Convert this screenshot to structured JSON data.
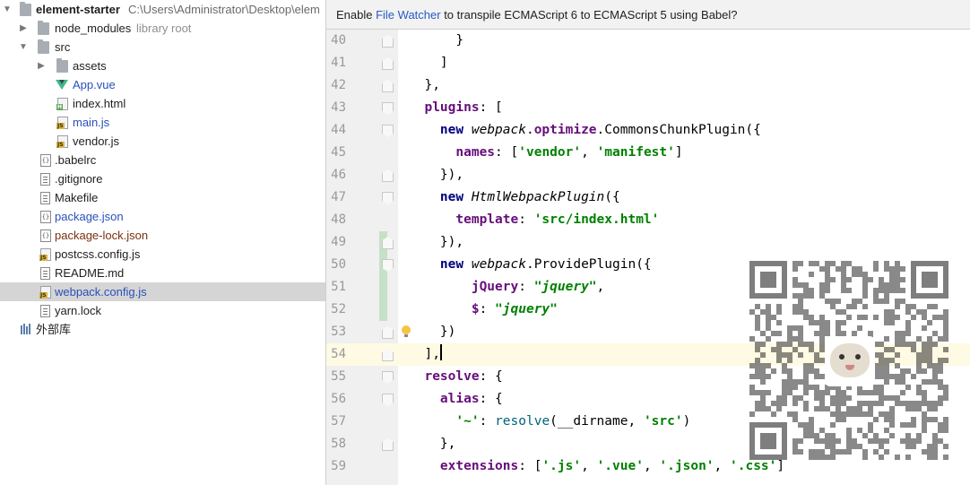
{
  "project_tree": {
    "root": {
      "name": "element-starter",
      "path": "C:\\Users\\Administrator\\Desktop\\elem"
    },
    "items": [
      {
        "label": "node_modules",
        "note": "library root"
      },
      {
        "label": "src"
      },
      {
        "label": "assets"
      },
      {
        "label": "App.vue"
      },
      {
        "label": "index.html"
      },
      {
        "label": "main.js"
      },
      {
        "label": "vendor.js"
      },
      {
        "label": ".babelrc"
      },
      {
        "label": ".gitignore"
      },
      {
        "label": "Makefile"
      },
      {
        "label": "package.json"
      },
      {
        "label": "package-lock.json"
      },
      {
        "label": "postcss.config.js"
      },
      {
        "label": "README.md"
      },
      {
        "label": "webpack.config.js"
      },
      {
        "label": "yarn.lock"
      },
      {
        "label": "外部库"
      }
    ]
  },
  "notification": {
    "prefix": "Enable ",
    "link": "File Watcher",
    "suffix": " to transpile ECMAScript 6 to ECMAScript 5 using Babel?"
  },
  "editor": {
    "line_numbers": [
      "40",
      "41",
      "42",
      "43",
      "44",
      "45",
      "46",
      "47",
      "48",
      "49",
      "50",
      "51",
      "52",
      "53",
      "54",
      "55",
      "56",
      "57",
      "58",
      "59"
    ],
    "lines": {
      "l40": "      }",
      "l41": "    ]",
      "l42": "  },",
      "l43_prop": "plugins",
      "l43_rest": ": [",
      "l44_kw": "new",
      "l44_obj": "webpack",
      "l44_mid": "optimize",
      "l44_fn": "CommonsChunkPlugin",
      "l44_end": "({",
      "l45_prop": "names",
      "l45_s1": "'vendor'",
      "l45_s2": "'manifest'",
      "l46": "    }),",
      "l47_kw": "new",
      "l47_fn": "HtmlWebpackPlugin",
      "l47_end": "({",
      "l48_prop": "template",
      "l48_str": "'src/index.html'",
      "l49": "    }),",
      "l50_kw": "new",
      "l50_obj": "webpack",
      "l50_fn": "ProvidePlugin",
      "l50_end": "({",
      "l51_prop": "jQuery",
      "l51_str": "\"jquery\"",
      "l52_prop": "$",
      "l52_str": "\"jquery\"",
      "l53": "    })",
      "l54": "  ],",
      "l55_prop": "resolve",
      "l55_rest": ": {",
      "l56_prop": "alias",
      "l56_rest": ": {",
      "l57_key": "'~'",
      "l57_fn": "resolve",
      "l57_arg": "__dirname",
      "l57_str": "'src'",
      "l58": "    },",
      "l59_prop": "extensions",
      "l59_s1": "'.js'",
      "l59_s2": "'.vue'",
      "l59_s3": "'.json'",
      "l59_s4": "'.css'"
    }
  },
  "colors": {
    "keyword": "#000080",
    "property": "#660e7a",
    "string": "#008000",
    "selection": "#d5d5d5",
    "current_line": "#fffae3",
    "link": "#2a59c9"
  },
  "icons": [
    "chevron-down-icon",
    "chevron-right-icon",
    "folder-icon",
    "vue-file-icon",
    "html-file-icon",
    "js-file-icon",
    "config-file-icon",
    "text-file-icon",
    "library-icon",
    "fold-marker-icon",
    "lightbulb-icon",
    "qr-code"
  ]
}
